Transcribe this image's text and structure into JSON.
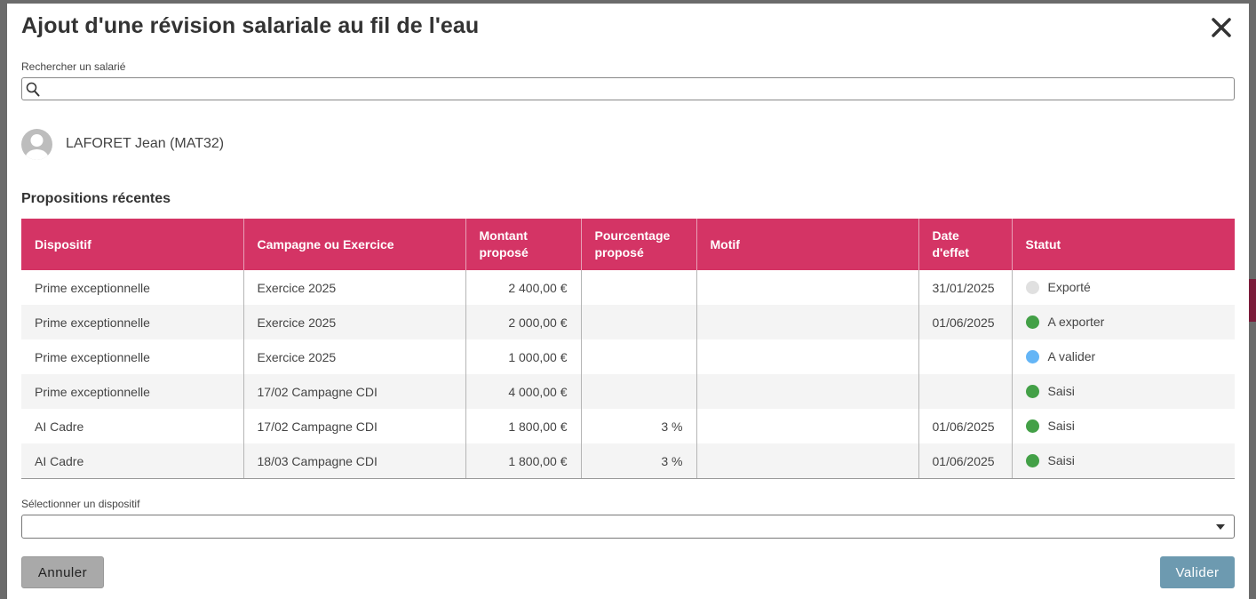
{
  "modal": {
    "title": "Ajout d'une révision salariale au fil de l'eau",
    "close_icon": "close-icon"
  },
  "search": {
    "label": "Rechercher un salarié",
    "value": "",
    "placeholder": "",
    "icon": "search-icon"
  },
  "employee": {
    "name": "LAFORET Jean (MAT32)",
    "icon": "avatar-icon"
  },
  "recent": {
    "title": "Propositions récentes",
    "columns": [
      "Dispositif",
      "Campagne ou Exercice",
      "Montant proposé",
      "Pourcentage proposé",
      "Motif",
      "Date d'effet",
      "Statut"
    ],
    "rows": [
      {
        "dispositif": "Prime exceptionnelle",
        "campagne": "Exercice 2025",
        "montant": "2 400,00 €",
        "pourcentage": "",
        "motif": "",
        "date": "31/01/2025",
        "statut": "Exporté",
        "statut_color": "#e0e0e0"
      },
      {
        "dispositif": "Prime exceptionnelle",
        "campagne": "Exercice 2025",
        "montant": "2 000,00 €",
        "pourcentage": "",
        "motif": "",
        "date": "01/06/2025",
        "statut": "A exporter",
        "statut_color": "#43a047"
      },
      {
        "dispositif": "Prime exceptionnelle",
        "campagne": "Exercice 2025",
        "montant": "1 000,00 €",
        "pourcentage": "",
        "motif": "",
        "date": "",
        "statut": "A valider",
        "statut_color": "#64b5f6"
      },
      {
        "dispositif": "Prime exceptionnelle",
        "campagne": "17/02 Campagne CDI",
        "montant": "4 000,00 €",
        "pourcentage": "",
        "motif": "",
        "date": "",
        "statut": "Saisi",
        "statut_color": "#43a047"
      },
      {
        "dispositif": "AI Cadre",
        "campagne": "17/02 Campagne CDI",
        "montant": "1 800,00 €",
        "pourcentage": "3 %",
        "motif": "",
        "date": "01/06/2025",
        "statut": "Saisi",
        "statut_color": "#43a047"
      },
      {
        "dispositif": "AI Cadre",
        "campagne": "18/03 Campagne CDI",
        "montant": "1 800,00 €",
        "pourcentage": "3 %",
        "motif": "",
        "date": "01/06/2025",
        "statut": "Saisi",
        "statut_color": "#43a047"
      }
    ]
  },
  "dispositif_select": {
    "label": "Sélectionner un dispositif",
    "value": "",
    "icon": "chevron-down-icon"
  },
  "buttons": {
    "cancel": "Annuler",
    "validate": "Valider"
  },
  "colors": {
    "header_bg": "#d43465",
    "validate_bg": "#6d9ab0",
    "cancel_bg": "#a9a9a9"
  }
}
